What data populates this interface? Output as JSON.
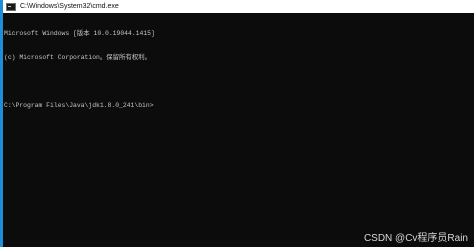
{
  "window": {
    "title": "C:\\Windows\\System32\\cmd.exe"
  },
  "terminal": {
    "lines": [
      "Microsoft Windows [版本 10.0.19044.1415]",
      "(c) Microsoft Corporation。保留所有权利。",
      "",
      "C:\\Program Files\\Java\\jdk1.8.0_241\\bin>"
    ]
  },
  "watermark": "CSDN @Cv程序员Rain",
  "colors": {
    "titlebar_bg": "#ffffff",
    "console_bg": "#0c0c0c",
    "console_text": "#c6c6c6",
    "accent_border": "#1e8fd6"
  },
  "icons": {
    "app": "cmd-console-icon"
  }
}
